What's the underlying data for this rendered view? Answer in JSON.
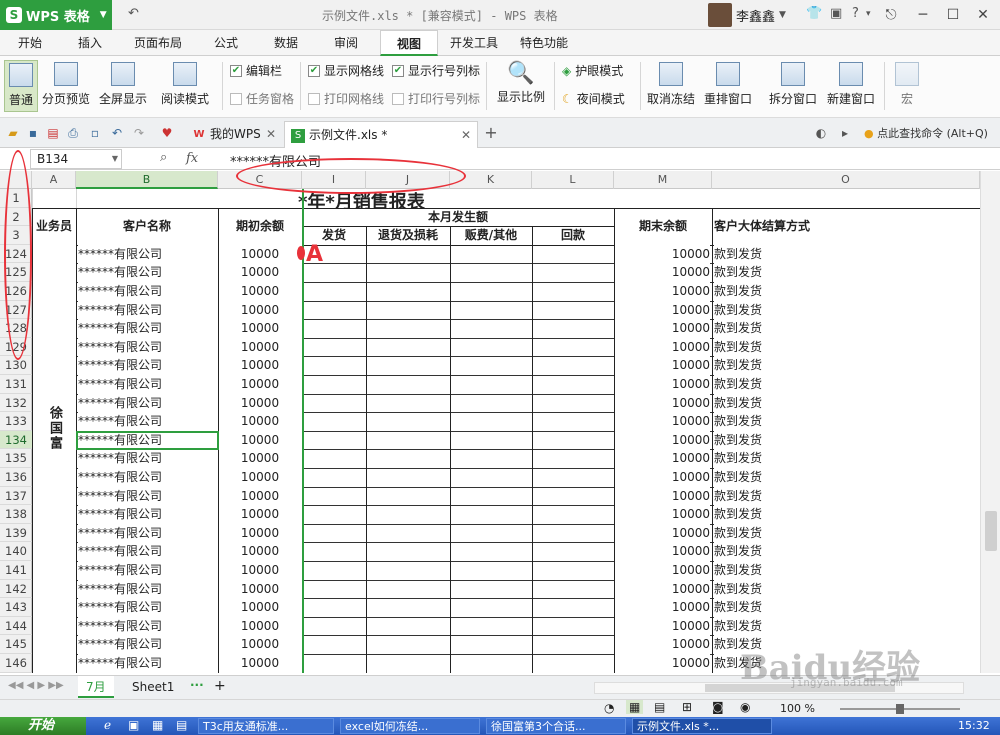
{
  "app": {
    "name": "WPS 表格",
    "doc_title": "示例文件.xls * [兼容模式] - WPS 表格",
    "user": "李鑫鑫"
  },
  "menu_tabs": [
    "开始",
    "插入",
    "页面布局",
    "公式",
    "数据",
    "审阅",
    "视图",
    "开发工具",
    "特色功能"
  ],
  "ribbon": {
    "view_buttons": [
      "普通",
      "分页预览",
      "全屏显示",
      "阅读模式"
    ],
    "checks": [
      {
        "label": "编辑栏",
        "checked": true
      },
      {
        "label": "任务窗格",
        "checked": false
      },
      {
        "label": "显示网格线",
        "checked": true
      },
      {
        "label": "打印网格线",
        "checked": false
      },
      {
        "label": "显示行号列标",
        "checked": true
      },
      {
        "label": "打印行号列标",
        "checked": false
      }
    ],
    "zoom_label": "显示比例",
    "eye_mode": "护眼模式",
    "night_mode": "夜间模式",
    "right_buttons": [
      "取消冻结",
      "重排窗口",
      "拆分窗口",
      "新建窗口",
      "宏"
    ]
  },
  "doc_tabs": [
    {
      "label": "我的WPS",
      "active": false
    },
    {
      "label": "示例文件.xls *",
      "active": true
    }
  ],
  "search_cmd": "点此查找命令 (Alt+Q)",
  "formula_bar": {
    "cell_ref": "B134",
    "fx": "fx",
    "value": "******有限公司"
  },
  "columns": [
    {
      "label": "A"
    },
    {
      "label": "B",
      "selected": true
    },
    {
      "label": "C"
    },
    {
      "label": "I"
    },
    {
      "label": "J"
    },
    {
      "label": "K"
    },
    {
      "label": "L"
    },
    {
      "label": "M"
    },
    {
      "label": "O"
    }
  ],
  "row_labels": [
    "1",
    "2",
    "3",
    "124",
    "125",
    "126",
    "127",
    "128",
    "129",
    "130",
    "131",
    "132",
    "133",
    "134",
    "135",
    "136",
    "137",
    "138",
    "139",
    "140",
    "141",
    "142",
    "143",
    "144",
    "145",
    "146"
  ],
  "selected_row": "134",
  "table": {
    "title": "*年*月销售报表",
    "headers": {
      "salesman": "业务员",
      "customer": "客户名称",
      "opening": "期初余额",
      "month_group": "本月发生额",
      "ship": "发货",
      "return_loss": "退货及损耗",
      "rebate_other": "贩费/其他",
      "payment": "回款",
      "closing": "期末余额",
      "settlement": "客户大体结算方式"
    },
    "salesman_name": "徐国富",
    "customer_name": "******有限公司",
    "opening_value": "10000",
    "closing_value": "10000",
    "settlement_value": "款到发货"
  },
  "sheet_tabs": [
    "7月",
    "Sheet1"
  ],
  "status": {
    "zoom": "100 %"
  },
  "taskbar": {
    "start": "开始",
    "tasks": [
      "T3c用友通标准...",
      "excel如何冻结...",
      "徐国富第3个合话...",
      "示例文件.xls *..."
    ],
    "clock": "15:32"
  },
  "annotation": {
    "label": "A",
    "color": "#e8323a"
  },
  "watermark": {
    "main": "Baidu经验",
    "sub": "jingyan.baidu.com"
  },
  "colors": {
    "accent": "#2e9e3f",
    "annotation": "#e8323a"
  }
}
